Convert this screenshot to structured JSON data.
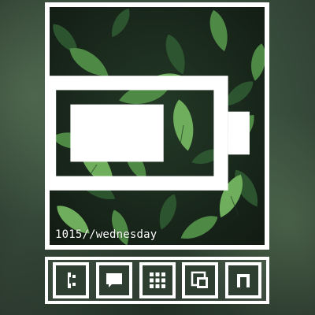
{
  "screen": {
    "date_text": "1015//wednesday"
  },
  "status": {
    "battery_icon": "battery-icon"
  },
  "colors": {
    "frame": "#ffffff",
    "leaf_light": "#6fae5c",
    "leaf_dark": "#2f5a32",
    "background": "#3c5240"
  },
  "dock": {
    "buttons": [
      {
        "icon": "phone-icon"
      },
      {
        "icon": "message-icon"
      },
      {
        "icon": "grid-icon"
      },
      {
        "icon": "gallery-icon"
      },
      {
        "icon": "music-icon"
      }
    ]
  }
}
